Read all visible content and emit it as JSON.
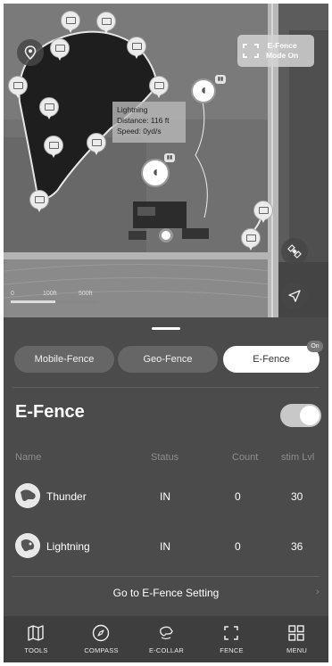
{
  "map": {
    "efence_badge": {
      "line1": "E-Fence",
      "line2": "Mode On"
    },
    "info_card": {
      "name": "Lightning",
      "distance": "Distance: 116 ft",
      "speed": "Speed: 0yd/s"
    },
    "scale": {
      "label_start": "0",
      "label_mid": "100ft",
      "label_end": "500ft"
    },
    "icons": {
      "location": "location-pin-icon",
      "satellite": "satellite-icon",
      "navigate": "navigation-arrow-icon"
    }
  },
  "tabs": [
    {
      "label": "Mobile-Fence",
      "active": false
    },
    {
      "label": "Geo-Fence",
      "active": false
    },
    {
      "label": "E-Fence",
      "active": true
    }
  ],
  "on_badge": "On",
  "section": {
    "title": "E-Fence",
    "toggle_on": true
  },
  "table": {
    "headers": {
      "name": "Name",
      "status": "Status",
      "count": "Count",
      "stim": "stim Lvl"
    },
    "rows": [
      {
        "name": "Thunder",
        "status": "IN",
        "count": "0",
        "stim": "30"
      },
      {
        "name": "Lightning",
        "status": "IN",
        "count": "0",
        "stim": "36"
      }
    ]
  },
  "goto_setting": "Go to E-Fence Setting",
  "goto_chevron": "›",
  "nav": [
    {
      "label": "TOOLS",
      "icon": "map-icon"
    },
    {
      "label": "COMPASS",
      "icon": "compass-icon"
    },
    {
      "label": "E-COLLAR",
      "icon": "e-collar-icon"
    },
    {
      "label": "FENCE",
      "icon": "fence-icon"
    },
    {
      "label": "MENU",
      "icon": "grid-menu-icon"
    }
  ],
  "colors": {
    "panel_bg": "#4b4b4b",
    "nav_bg": "#3e3e3e",
    "active_tab": "#ffffff",
    "toggle": "#c8c8c8"
  }
}
